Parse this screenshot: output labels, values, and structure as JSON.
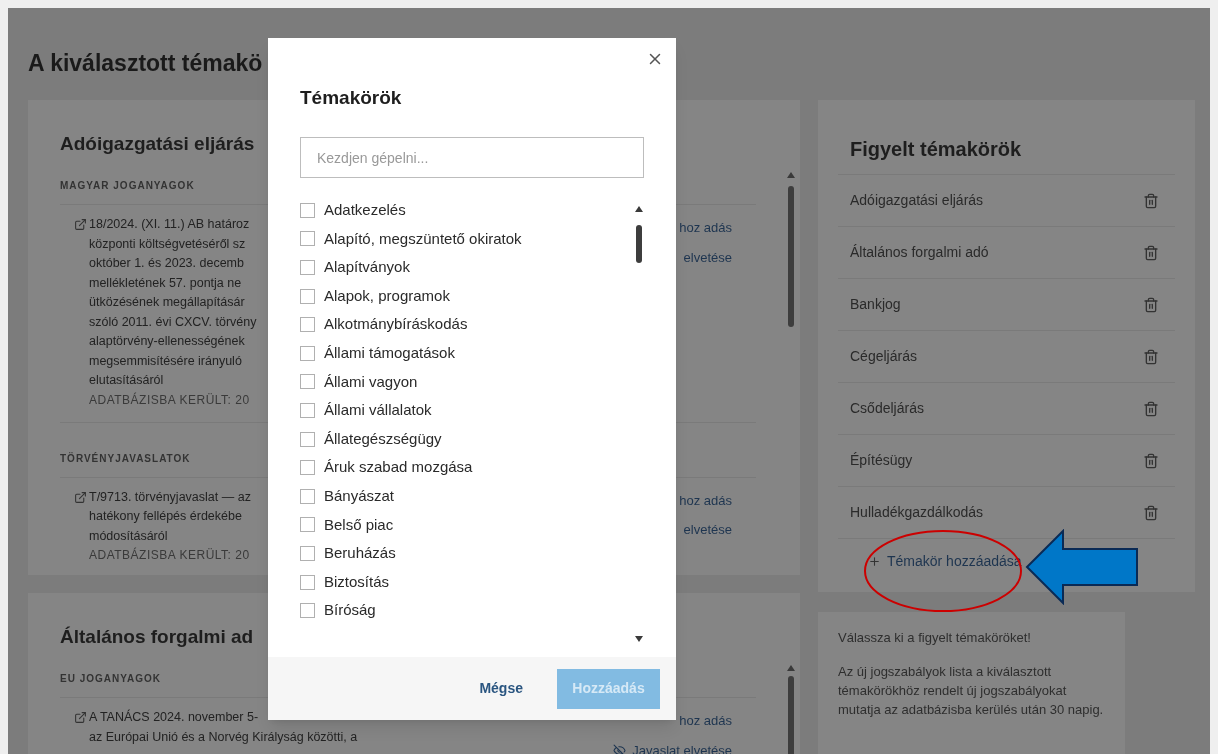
{
  "page_title": "A kiválasztott témakö",
  "sections": [
    {
      "title": "Adóigazgatási eljárás",
      "groups": [
        {
          "label": "MAGYAR JOGANYAGOK",
          "items": [
            {
              "lines": [
                "18/2024. (XI. 11.) AB határoz",
                "központi költségvetéséről sz",
                "október 1. és 2023. decemb",
                "mellékletének 57. pontja ne",
                "ütközésének megállapításár",
                "szóló 2011. évi CXCV. törvény",
                "alaptörvény-ellenességének",
                "megsemmisítésére irányuló",
                "elutasításáról"
              ],
              "added": "ADATBÁZISBA KERÜLT: 20",
              "actions": [
                {
                  "label": "hoz adás",
                  "icon": false
                },
                {
                  "label": "elvetése",
                  "icon": false
                }
              ]
            }
          ]
        },
        {
          "label": "TÖRVÉNYJAVASLATOK",
          "items": [
            {
              "lines": [
                "T/9713. törvényjavaslat — az",
                "hatékony fellépés érdekébe",
                "módosításáról"
              ],
              "added": "ADATBÁZISBA KERÜLT: 20",
              "actions": [
                {
                  "label": "hoz adás",
                  "icon": false
                },
                {
                  "label": "elvetése",
                  "icon": false
                }
              ]
            }
          ]
        }
      ]
    },
    {
      "title": "Általános forgalmi ad",
      "groups": [
        {
          "label": "EU JOGANYAGOK",
          "items": [
            {
              "lines": [
                "A TANÁCS 2024. november 5-",
                "az Európai Unió és a Norvég Királyság közötti, a"
              ],
              "actions": [
                {
                  "label": "hoz adás",
                  "icon": false
                },
                {
                  "label": "Javaslat elvetése",
                  "icon": true
                }
              ]
            }
          ]
        }
      ]
    }
  ],
  "watched": {
    "title": "Figyelt témakörök",
    "items": [
      "Adóigazgatási eljárás",
      "Általános forgalmi adó",
      "Bankjog",
      "Cégeljárás",
      "Csődeljárás",
      "Építésügy",
      "Hulladékgazdálkodás"
    ],
    "add_label": "Témakör hozzáadása"
  },
  "info": {
    "heading": "Válassza ki a figyelt témaköröket!",
    "text": "Az új jogszabályok lista a kiválasztott témakörökhöz rendelt új jogszabályokat mutatja az adatbázisba kerülés után 30 napig."
  },
  "modal": {
    "title": "Témakörök",
    "search": {
      "placeholder": "Kezdjen gépelni..."
    },
    "options": [
      {
        "label": "Adatkezelés",
        "checked": false
      },
      {
        "label": "Alapító, megszüntető okiratok",
        "checked": false
      },
      {
        "label": "Alapítványok",
        "checked": false
      },
      {
        "label": "Alapok, programok",
        "checked": false
      },
      {
        "label": "Alkotmánybíráskodás",
        "checked": false
      },
      {
        "label": "Állami támogatások",
        "checked": false
      },
      {
        "label": "Állami vagyon",
        "checked": false
      },
      {
        "label": "Állami vállalatok",
        "checked": false
      },
      {
        "label": "Állategészségügy",
        "checked": false
      },
      {
        "label": "Áruk szabad mozgása",
        "checked": false
      },
      {
        "label": "Bányászat",
        "checked": false
      },
      {
        "label": "Belső piac",
        "checked": false
      },
      {
        "label": "Beruházás",
        "checked": false
      },
      {
        "label": "Biztosítás",
        "checked": false
      },
      {
        "label": "Bíróság",
        "checked": false
      }
    ],
    "cancel": "Mégse",
    "submit": {
      "label": "Hozzáadás",
      "disabled": true
    }
  }
}
